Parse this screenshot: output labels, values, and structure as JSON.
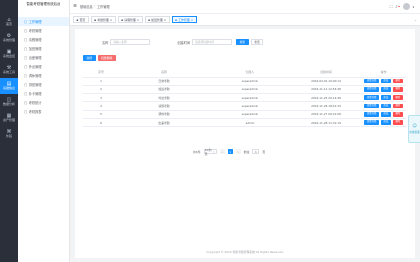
{
  "rail": [
    {
      "icon": "home-icon",
      "glyph": "⌂",
      "label": "首页",
      "active": false
    },
    {
      "icon": "settings-icon",
      "glyph": "⚙",
      "label": "系统管理",
      "active": false
    },
    {
      "icon": "monitor-icon",
      "glyph": "▣",
      "label": "系统监控",
      "active": false
    },
    {
      "icon": "tool-icon",
      "glyph": "⚒",
      "label": "系统工具",
      "active": false
    },
    {
      "icon": "book-icon",
      "glyph": "▤",
      "label": "基础信息",
      "active": true
    },
    {
      "icon": "chart-icon",
      "glyph": "◫",
      "label": "数据分析",
      "active": false
    },
    {
      "icon": "box-icon",
      "glyph": "▦",
      "label": "资产管理",
      "active": false
    },
    {
      "icon": "link-icon",
      "glyph": "⌘",
      "label": "外链",
      "active": false
    }
  ],
  "sidebar": {
    "brand": "智能考勤管理系统后台",
    "items": [
      {
        "label": "工作管理",
        "active": true
      },
      {
        "label": "考勤管理",
        "active": false
      },
      {
        "label": "请假管理",
        "active": false
      },
      {
        "label": "加班管理",
        "active": false
      },
      {
        "label": "出差管理",
        "active": false
      },
      {
        "label": "外出管理",
        "active": false
      },
      {
        "label": "调休管理",
        "active": false
      },
      {
        "label": "排班管理",
        "active": false
      },
      {
        "label": "补卡管理",
        "active": false
      },
      {
        "label": "考勤统计",
        "active": false
      },
      {
        "label": "考勤报表",
        "active": false
      }
    ]
  },
  "header": {
    "breadcrumb": [
      "基础信息",
      "工作管理"
    ]
  },
  "tabs": [
    {
      "label": "首页",
      "active": false,
      "closable": false
    },
    {
      "label": "考勤管理",
      "active": false,
      "closable": true
    },
    {
      "label": "请假管理",
      "active": false,
      "closable": true
    },
    {
      "label": "加班管理",
      "active": false,
      "closable": true
    },
    {
      "label": "工作管理",
      "active": true,
      "closable": true
    }
  ],
  "search": {
    "name_label": "名称",
    "name_placeholder": "请输入名称",
    "time_label": "创建时间",
    "time_placeholder": "请选择创建时间",
    "search_button": "搜索",
    "reset_button": "重置"
  },
  "toolbar": {
    "add_button": "新增",
    "batch_delete_button": "批量删除"
  },
  "table": {
    "columns": [
      "序号",
      "名称",
      "创建人",
      "创建时间",
      "操作"
    ],
    "rows": [
      {
        "no": "1",
        "name": "日常考勤",
        "creator": "superadmin",
        "time": "2024-04-01 10:00:14"
      },
      {
        "no": "2",
        "name": "加班考勤",
        "creator": "superadmin",
        "time": "2024-11-11 12:54:48"
      },
      {
        "no": "3",
        "name": "外出考勤",
        "creator": "superadmin",
        "time": "2024-11-25 20:14:48"
      },
      {
        "no": "4",
        "name": "请假考勤",
        "creator": "superadmin",
        "time": "2024-11-26 18:41:34"
      },
      {
        "no": "5",
        "name": "调休考勤",
        "creator": "superadmin",
        "time": "2024-11-27 09:21:08"
      },
      {
        "no": "6",
        "name": "出差考勤",
        "creator": "admin",
        "time": "2024-11-28 11:31:19"
      }
    ],
    "op_labels": [
      "查看详情",
      "修改",
      "删除"
    ]
  },
  "pagination": {
    "total": "共6条",
    "page_size": "10条/页",
    "prev": "‹",
    "current": "1",
    "next": "›",
    "jump_prefix": "前往",
    "jump_value": "1",
    "jump_suffix": "页"
  },
  "footer": "Copyright © 2024 智能考勤管理系统 All Rights Reserved.",
  "float_widget": {
    "icon": "chat-icon",
    "glyph": "☺",
    "label": "在线客服"
  },
  "colors": {
    "primary": "#1890ff",
    "danger": "#f56c6c",
    "rail_bg": "#2b2f3a"
  }
}
